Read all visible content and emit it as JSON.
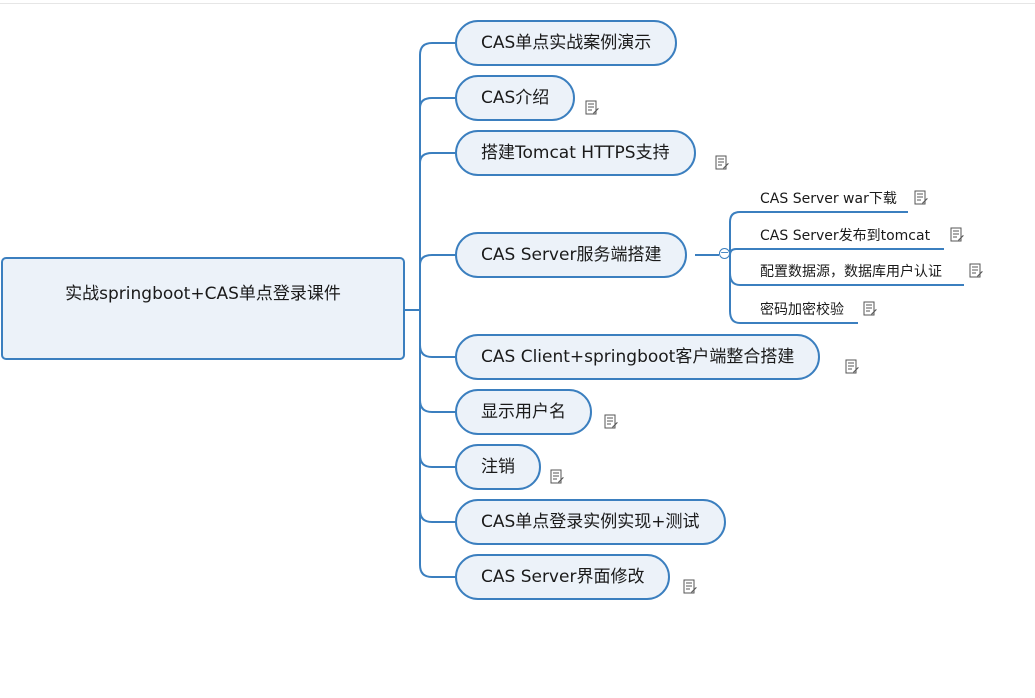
{
  "root": {
    "label": "实战springboot+CAS单点登录课件"
  },
  "topics": [
    {
      "label": "CAS单点实战案例演示"
    },
    {
      "label": "CAS介绍"
    },
    {
      "label": "搭建Tomcat HTTPS支持"
    },
    {
      "label": "CAS Server服务端搭建"
    },
    {
      "label": "CAS Client+springboot客户端整合搭建"
    },
    {
      "label": "显示用户名"
    },
    {
      "label": "注销"
    },
    {
      "label": "CAS单点登录实例实现+测试"
    },
    {
      "label": "CAS Server界面修改"
    }
  ],
  "subtopics": [
    {
      "label": "CAS Server war下载"
    },
    {
      "label": "CAS Server发布到tomcat"
    },
    {
      "label": "配置数据源，数据库用户认证"
    },
    {
      "label": "密码加密校验"
    }
  ],
  "collapse_symbol": "−",
  "colors": {
    "line": "#3b7fbf",
    "fill": "#ecf2f9"
  },
  "icons": {
    "note": "note-icon"
  }
}
